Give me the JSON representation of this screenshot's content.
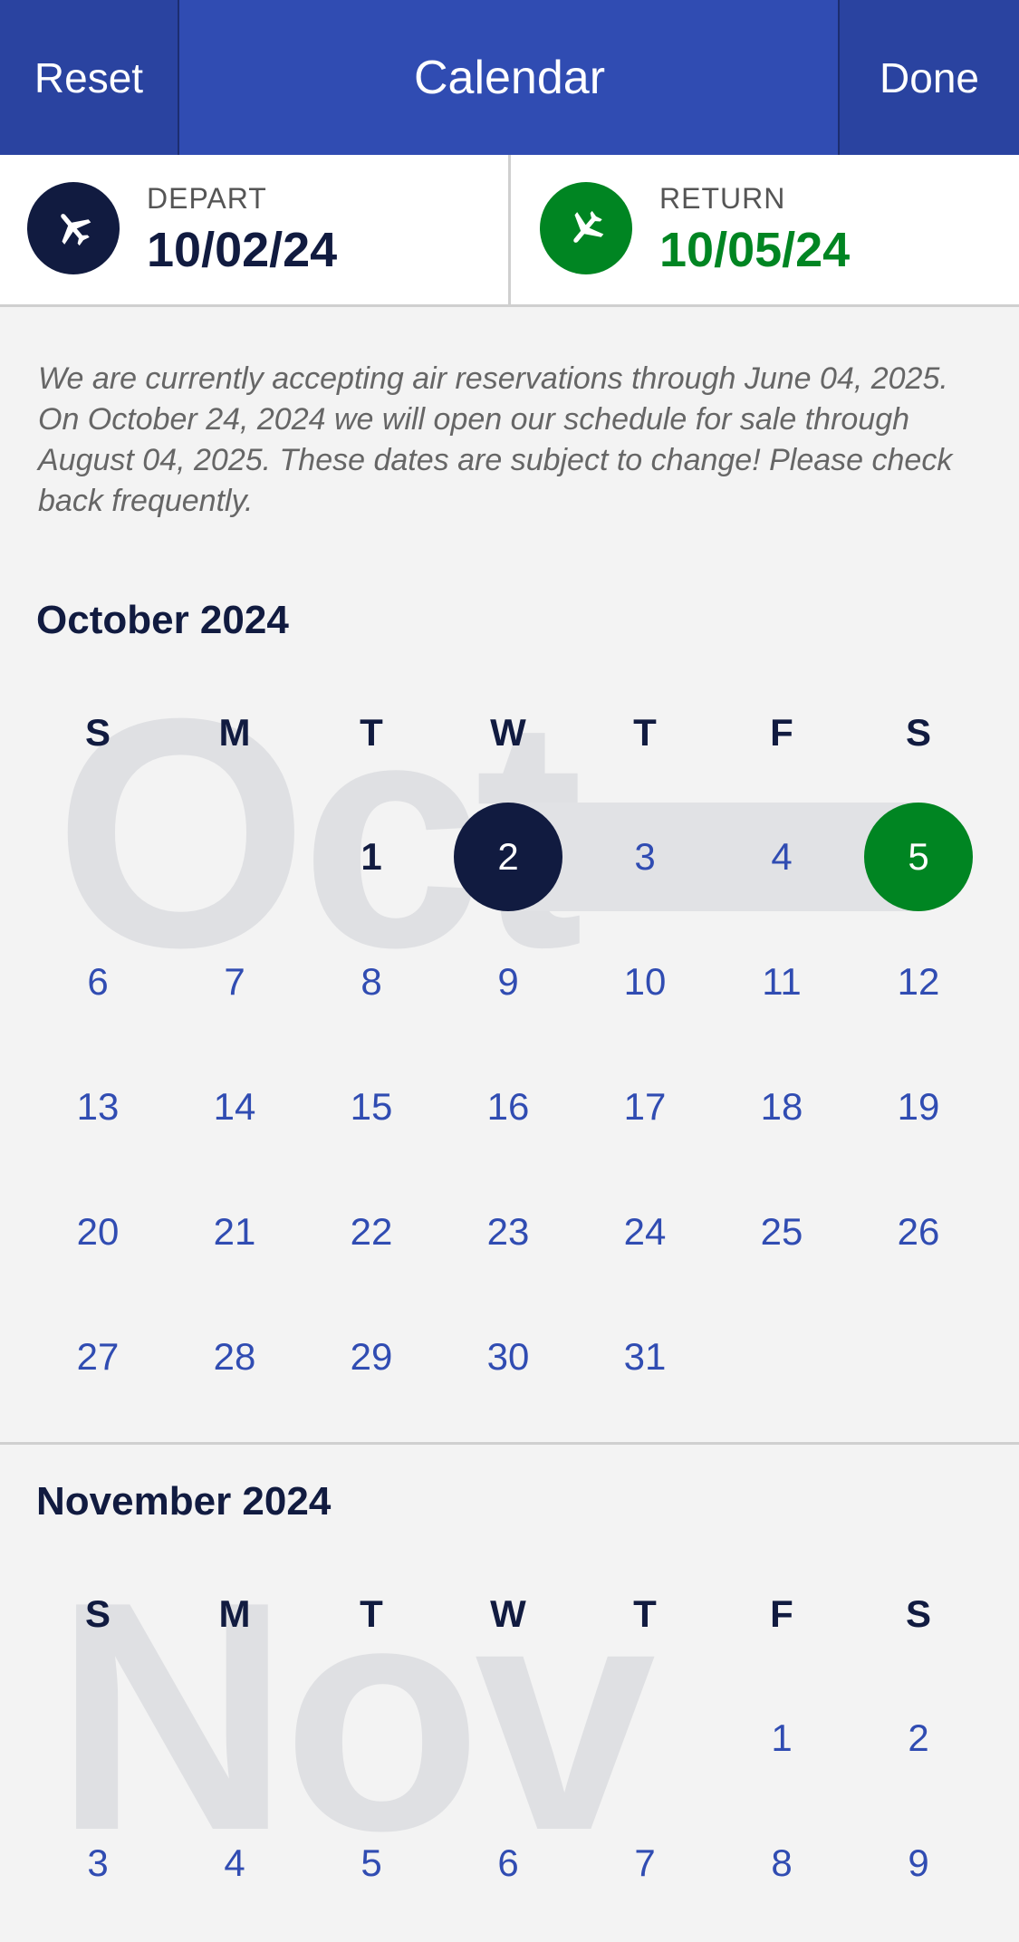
{
  "header": {
    "reset_label": "Reset",
    "title": "Calendar",
    "done_label": "Done"
  },
  "trip": {
    "depart_label": "DEPART",
    "depart_value": "10/02/24",
    "return_label": "RETURN",
    "return_value": "10/05/24"
  },
  "notice": "We are currently accepting air reservations through June 04, 2025. On October 24, 2024 we will open our schedule for sale through August 04, 2025. These dates are subject to change! Please check back frequently.",
  "weekdays": [
    "S",
    "M",
    "T",
    "W",
    "T",
    "F",
    "S"
  ],
  "october": {
    "title": "October 2024",
    "watermark": "Oct",
    "days": [
      "1",
      "2",
      "3",
      "4",
      "5",
      "6",
      "7",
      "8",
      "9",
      "10",
      "11",
      "12",
      "13",
      "14",
      "15",
      "16",
      "17",
      "18",
      "19",
      "20",
      "21",
      "22",
      "23",
      "24",
      "25",
      "26",
      "27",
      "28",
      "29",
      "30",
      "31"
    ]
  },
  "november": {
    "title": "November 2024",
    "watermark": "Nov",
    "days": [
      "1",
      "2",
      "3",
      "4",
      "5",
      "6",
      "7",
      "8",
      "9"
    ]
  },
  "colors": {
    "brand_blue": "#304cb2",
    "navy": "#111b40",
    "return_green": "#008522",
    "range_gray": "#e1e2e5"
  },
  "icons": {
    "depart": "airplane-icon",
    "return": "airplane-icon"
  }
}
